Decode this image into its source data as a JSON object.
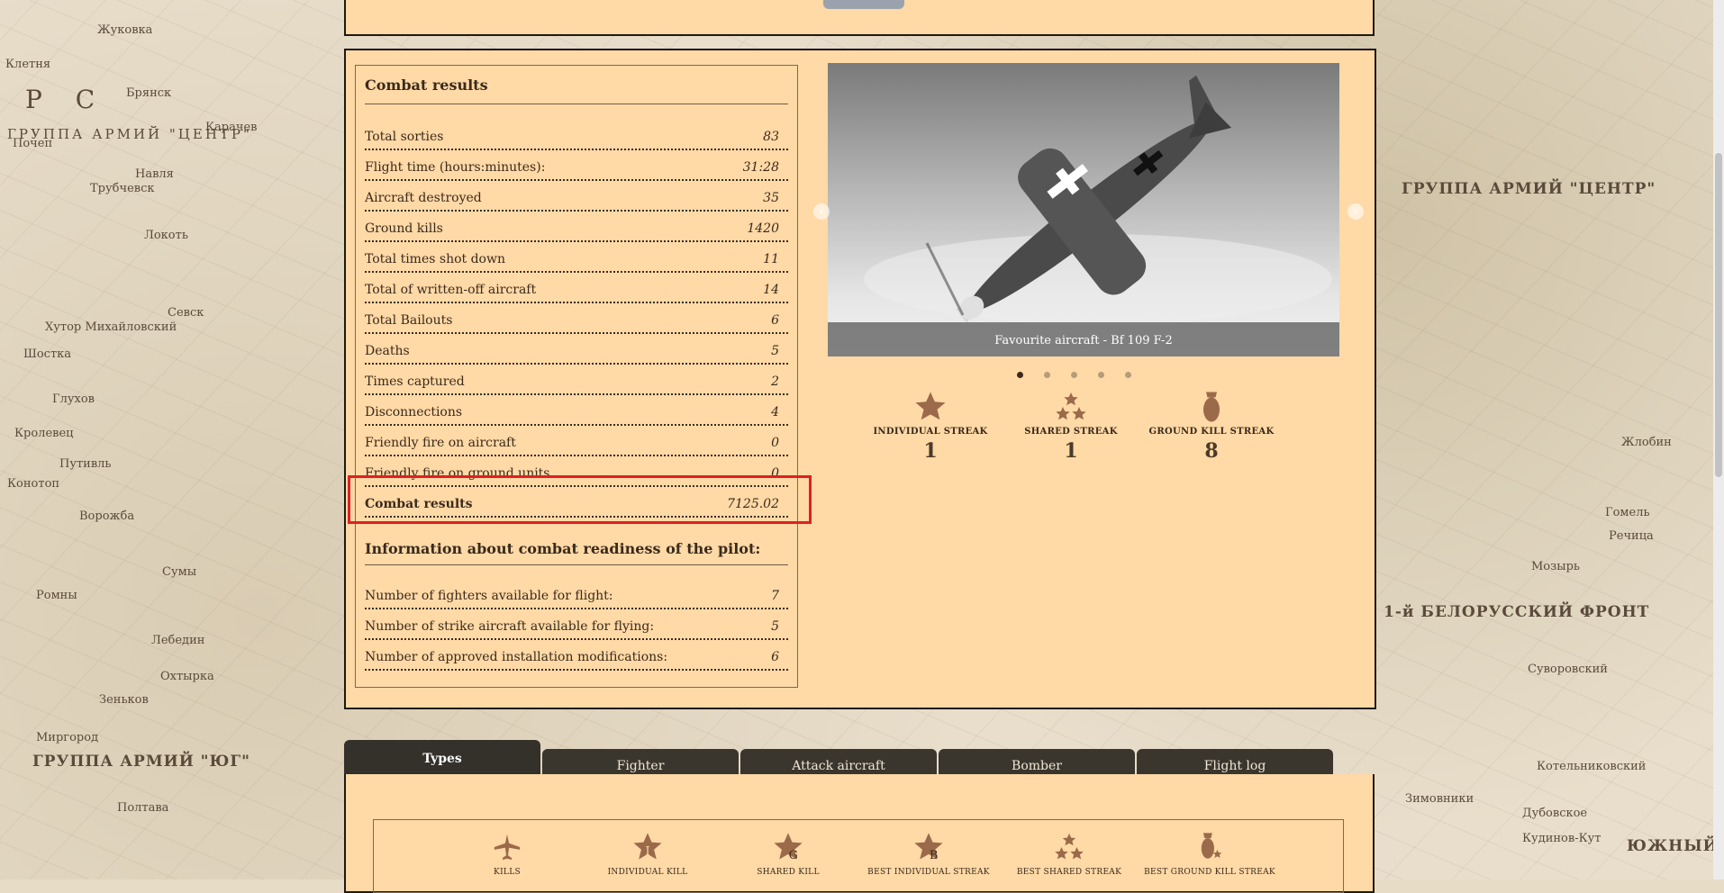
{
  "map": {
    "labels": [
      "Клетня",
      "Брянск",
      "Жуковка",
      "Карачев",
      "Почеп",
      "Навля",
      "Трубчевск",
      "Локоть",
      "Севск",
      "Хутор Михайловский",
      "Шостка",
      "Глухов",
      "Кролевец",
      "Путивль",
      "Конотоп",
      "Ворожба",
      "Сумы",
      "Ромны",
      "Лебедин",
      "Охтырка",
      "Зеньков",
      "Миргород",
      "Полтава",
      "Гомель",
      "Мозырь",
      "Речица",
      "Жлобин",
      "Суворовский",
      "Котельниковский",
      "Зимовники",
      "Дубовское",
      "Кудинов-Кут"
    ],
    "group_center_left": "ГРУППА АРМИЙ \"ЦЕНТР\"",
    "group_south": "ГРУППА АРМИЙ \"ЮГ\"",
    "group_center_right": "ГРУППА АРМИЙ \"ЦЕНТР\"",
    "front_belorussian": "1-й БЕЛОРУССКИЙ ФРОНТ",
    "front_south": "ЮЖНЫЙ ФРОНТ"
  },
  "stats": {
    "title": "Combat results",
    "rows": [
      {
        "label": "Total sorties",
        "value": "83"
      },
      {
        "label": "Flight time (hours:minutes):",
        "value": "31:28"
      },
      {
        "label": "Aircraft destroyed",
        "value": "35"
      },
      {
        "label": "Ground kills",
        "value": "1420"
      },
      {
        "label": "Total times shot down",
        "value": "11"
      },
      {
        "label": "Total of written-off aircraft",
        "value": "14"
      },
      {
        "label": "Total Bailouts",
        "value": "6"
      },
      {
        "label": "Deaths",
        "value": "5"
      },
      {
        "label": "Times captured",
        "value": "2"
      },
      {
        "label": "Disconnections",
        "value": "4"
      },
      {
        "label": "Friendly fire on aircraft",
        "value": "0"
      },
      {
        "label": "Friendly fire on ground units",
        "value": "0"
      },
      {
        "label": "Combat results",
        "value": "7125.02"
      }
    ],
    "readiness_title": "Information about combat readiness of the pilot:",
    "readiness_rows": [
      {
        "label": "Number of fighters available for flight:",
        "value": "7"
      },
      {
        "label": "Number of strike aircraft available for flying:",
        "value": "5"
      },
      {
        "label": "Number of approved installation modifications:",
        "value": "6"
      }
    ]
  },
  "carousel": {
    "caption": "Favourite aircraft - Bf 109 F-2",
    "prev": "‹",
    "next": "›",
    "slide_count": 5,
    "active_slide": 1
  },
  "streaks": [
    {
      "label": "INDIVIDUAL STREAK",
      "value": "1",
      "icon": "star-icon"
    },
    {
      "label": "SHARED STREAK",
      "value": "1",
      "icon": "triple-star-icon"
    },
    {
      "label": "GROUND KILL STREAK",
      "value": "8",
      "icon": "bomb-icon"
    }
  ],
  "tabs": [
    "Types",
    "Fighter",
    "Attack aircraft",
    "Bomber",
    "Flight log"
  ],
  "awards": [
    {
      "label": "KILLS",
      "icon": "plane-icon"
    },
    {
      "label": "INDIVIDUAL KILL",
      "icon": "star-i-icon"
    },
    {
      "label": "SHARED KILL",
      "icon": "star-g-icon"
    },
    {
      "label": "BEST INDIVIDUAL STREAK",
      "icon": "star-b-icon"
    },
    {
      "label": "BEST SHARED STREAK",
      "icon": "triple-star-icon"
    },
    {
      "label": "BEST GROUND KILL STREAK",
      "icon": "bomb-star-icon"
    }
  ],
  "colors": {
    "panel": "#ffd9a6",
    "border": "#1e1a14",
    "highlight": "#e02020",
    "tab": "#3a362e"
  }
}
